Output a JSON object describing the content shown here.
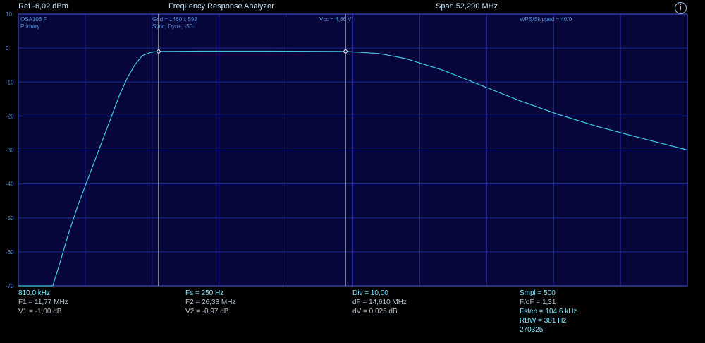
{
  "header": {
    "ref": "Ref  -6,02 dBm",
    "title": "Frequency Response Analyzer",
    "span": "Span 52,290 MHz",
    "help_glyph": "i"
  },
  "overlay": {
    "device": "OSA103 F",
    "mode": "Primary",
    "grid": "Grid = 1460 x 592",
    "sync": "Sync,  Dyn+,  -50-",
    "vcc": "Vcc = 4,86 V",
    "wps": "WPS/Skipped  = 40/0"
  },
  "y_axis": {
    "ticks": [
      "10",
      "0",
      "-10",
      "-20",
      "-30",
      "-40",
      "-50",
      "-60",
      "-70"
    ]
  },
  "readout": {
    "col1": [
      "810,0 kHz",
      "F1 = 11,77 MHz",
      "V1 = -1,00 dB"
    ],
    "col2": [
      "Fs = 250 Hz",
      "F2 = 26,38 MHz",
      "V2 = -0,97 dB"
    ],
    "col3": [
      "Div = 10,00",
      "dF = 14,610 MHz",
      "dV = 0,025 dB"
    ],
    "col4": [
      "Smpl = 500",
      "F/dF = 1,31",
      "Fstep = 104,6 kHz",
      "RBW = 381 Hz",
      "270325"
    ]
  },
  "colors": {
    "plot_bg": "#07063a",
    "grid": "#1c2a9c",
    "trace": "#3fc7e0",
    "marker_line": "#c8d0d8"
  },
  "chart_data": {
    "type": "line",
    "title": "Frequency Response Analyzer",
    "xlabel": "",
    "ylabel": "",
    "xlim": [
      0.81,
      53.1
    ],
    "ylim": [
      -70,
      10
    ],
    "grid": true,
    "x": [
      0.81,
      3.5,
      4.0,
      4.7,
      5.5,
      6.3,
      7.1,
      7.9,
      8.7,
      9.3,
      9.9,
      10.5,
      11.2,
      11.77,
      15,
      20,
      26.38,
      29,
      31,
      34,
      37,
      40,
      43,
      46,
      50,
      53.1
    ],
    "y": [
      -70,
      -70,
      -64,
      -55,
      -46,
      -38,
      -30,
      -22,
      -14,
      -9,
      -5,
      -2.2,
      -1.2,
      -1.0,
      -0.9,
      -0.9,
      -0.97,
      -1.6,
      -3.0,
      -6.5,
      -11,
      -15.5,
      -19.5,
      -23,
      -27,
      -30
    ],
    "markers": [
      {
        "name": "V1",
        "x": 11.77,
        "y": -1.0
      },
      {
        "name": "V2",
        "x": 26.38,
        "y": -0.97
      }
    ]
  }
}
